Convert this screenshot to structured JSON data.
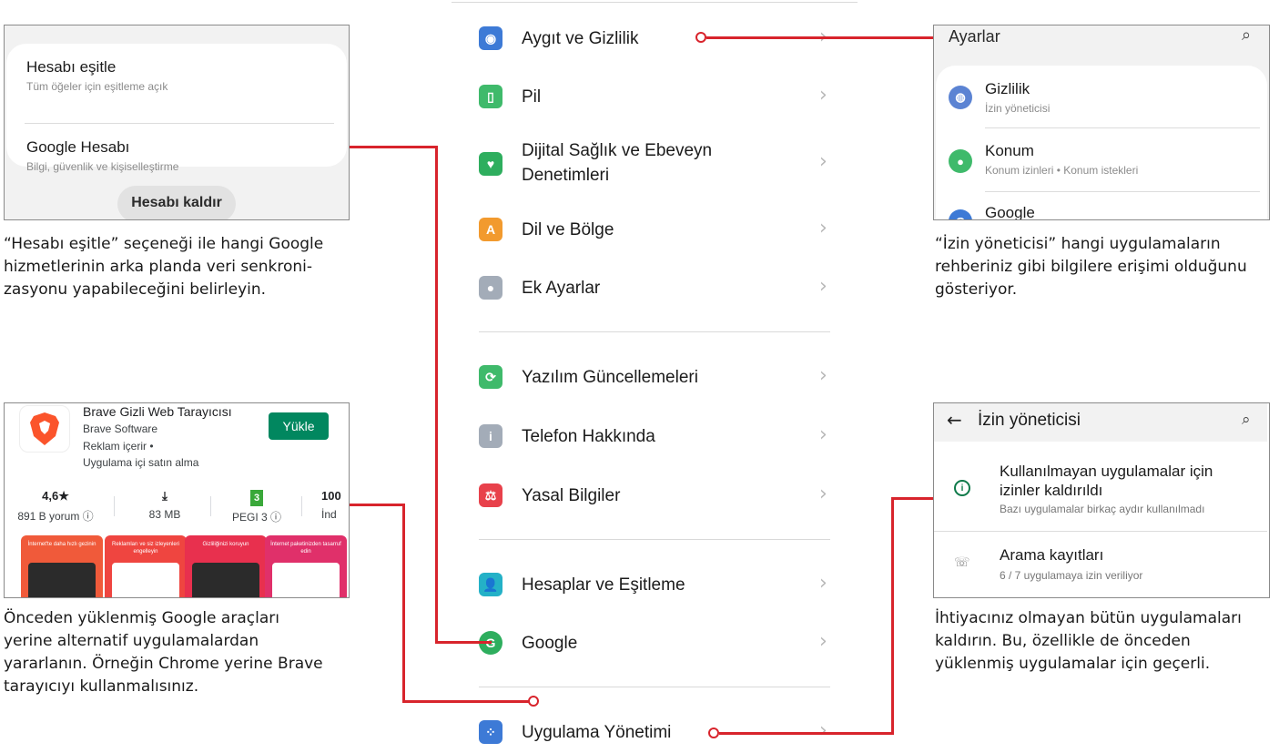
{
  "settings": {
    "items": [
      {
        "label": "Aygıt ve Gizlilik",
        "icon": "privacy-icon",
        "color": "#3d7ad6"
      },
      {
        "label": "Pil",
        "icon": "battery-icon",
        "color": "#3fba6b"
      },
      {
        "label": "Dijital Sağlık ve Ebeveyn",
        "label2": "Denetimleri",
        "icon": "wellbeing-icon",
        "color": "#2eae5e"
      },
      {
        "label": "Dil ve Bölge",
        "icon": "language-icon",
        "color": "#f29a2e"
      },
      {
        "label": "Ek Ayarlar",
        "icon": "additional-settings-icon",
        "color": "#a3acb8"
      },
      {
        "label": "Yazılım Güncellemeleri",
        "icon": "software-update-icon",
        "color": "#3fba6b"
      },
      {
        "label": "Telefon Hakkında",
        "icon": "info-icon",
        "color": "#a3acb8"
      },
      {
        "label": "Yasal Bilgiler",
        "icon": "legal-icon",
        "color": "#e8414b"
      },
      {
        "label": "Hesaplar ve Eşitleme",
        "icon": "accounts-icon",
        "color": "#24b1c7"
      },
      {
        "label": "Google",
        "icon": "google-icon",
        "color": "#2eae5e"
      },
      {
        "label": "Uygulama Yönetimi",
        "icon": "app-management-icon",
        "color": "#3d7ad6"
      }
    ]
  },
  "account_panel": {
    "sync_title": "Hesabı eşitle",
    "sync_sub": "Tüm öğeler için eşitleme açık",
    "google_title": "Google Hesabı",
    "google_sub": "Bilgi, güvenlik ve kişiselleştirme",
    "remove_button": "Hesabı kaldır",
    "caption_1": "“Hesabı eşitle” seçeneği ile hangi Google",
    "caption_2": "hizmetlerinin arka planda veri senkroni-",
    "caption_3": "zasyonu yapabileceğini belirleyin."
  },
  "privacy_panel": {
    "header": "Ayarlar",
    "items": [
      {
        "title": "Gizlilik",
        "sub": "İzin yöneticisi",
        "color": "#5b83d3"
      },
      {
        "title": "Konum",
        "sub": "Konum izinleri • Konum istekleri",
        "color": "#3fba6b"
      },
      {
        "title": "Google",
        "sub": "",
        "color": "#3d7ad6"
      }
    ],
    "caption_1": "“İzin yöneticisi” hangi uygulamaların",
    "caption_2": "rehberiniz gibi bilgilere erişimi olduğunu",
    "caption_3": "gösteriyor."
  },
  "store_panel": {
    "app_name": "Brave Gizli Web Tarayıcısı",
    "developer": "Brave Software",
    "ads": "Reklam içerir •",
    "iap": "Uygulama içi satın alma",
    "install_button": "Yükle",
    "stats": [
      {
        "value": "4,6★",
        "label": "891 B yorum ⓘ"
      },
      {
        "value": "⤓",
        "label": "83 MB"
      },
      {
        "value": "3",
        "label": "PEGI 3 ⓘ"
      },
      {
        "value": "100",
        "label": "İnd"
      }
    ],
    "screenshots": [
      "İnternet'te daha hızlı gezinin",
      "Reklamları ve siz izleyenleri engelleyin",
      "Gizliliğinizi koruyun",
      "İnternet paketinizden tasarruf edin"
    ],
    "caption_1": "Önceden yüklenmiş Google araçları",
    "caption_2": "yerine alternatif uygulamalardan",
    "caption_3": "yararlanın. Örneğin Chrome yerine Brave",
    "caption_4": "tarayıcıyı kullanmalısınız."
  },
  "permission_panel": {
    "title": "İzin yöneticisi",
    "item1_title": "Kullanılmayan uygulamalar için izinler kaldırıldı",
    "item1_sub": "Bazı uygulamalar birkaç aydır kullanılmadı",
    "item2_title": "Arama kayıtları",
    "item2_sub": "6 / 7 uygulamaya izin veriliyor",
    "caption_1": "İhtiyacınız olmayan bütün uygulamaları",
    "caption_2": "kaldırın. Bu, özellikle de önceden",
    "caption_3": "yüklenmiş uygulamalar için geçerli."
  },
  "colors": {
    "connector": "#d8242c",
    "install_green": "#01875f"
  }
}
